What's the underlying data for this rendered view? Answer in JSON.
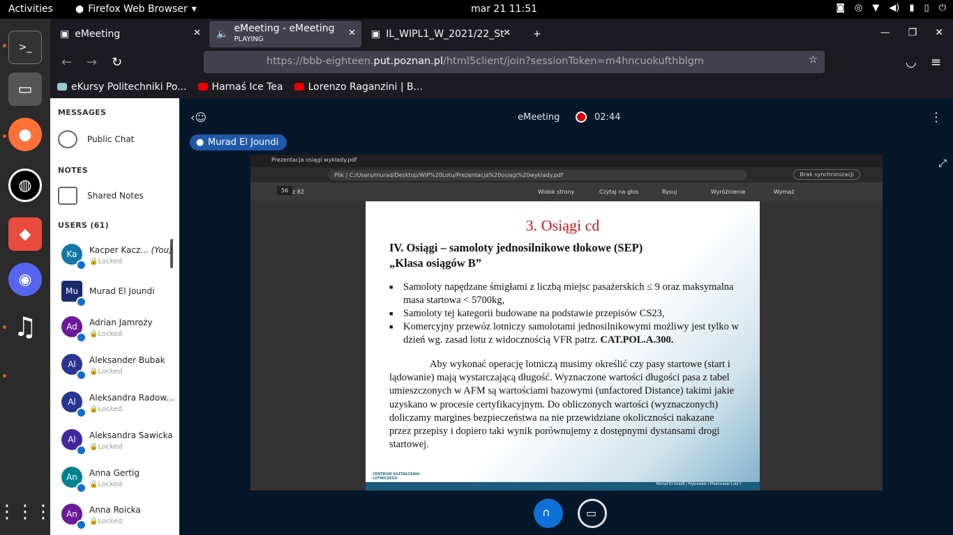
{
  "topbar": {
    "activities": "Activities",
    "app": "Firefox Web Browser",
    "clock": "mar 21  11:51"
  },
  "tabs": [
    {
      "title": "eMeeting"
    },
    {
      "title": "eMeeting - eMeeting",
      "sub": "PLAYING"
    },
    {
      "title": "IL_WIPL1_W_2021/22_St"
    }
  ],
  "url": {
    "host": "https://bbb-eighteen.",
    "domain": "put.poznan.pl",
    "path": "/html5client/join?sessionToken=m4hncuokufthblgm"
  },
  "bookmarks": [
    "eKursy Politechniki Po...",
    "Harnaś Ice Tea",
    "Lorenzo Raganzini | B..."
  ],
  "sidebar": {
    "messages": "MESSAGES",
    "public_chat": "Public Chat",
    "notes": "NOTES",
    "shared_notes": "Shared Notes",
    "users": "USERS (61)",
    "you": "(You)",
    "locked": "Locked"
  },
  "users": [
    {
      "initials": "Ka",
      "name": "Kacper Kacz...",
      "color": "#1477a8"
    },
    {
      "initials": "Mu",
      "name": "Murad El Joundi",
      "color": "#1a2a6c"
    },
    {
      "initials": "Ad",
      "name": "Adrian Jamroży",
      "color": "#6a1b9a"
    },
    {
      "initials": "Al",
      "name": "Aleksander Bubak",
      "color": "#283593"
    },
    {
      "initials": "Al",
      "name": "Aleksandra Radow...",
      "color": "#283593"
    },
    {
      "initials": "Al",
      "name": "Aleksandra Sawicka",
      "color": "#4527a0"
    },
    {
      "initials": "An",
      "name": "Anna Gertig",
      "color": "#00838f"
    },
    {
      "initials": "An",
      "name": "Anna Roicka",
      "color": "#6a1b9a"
    }
  ],
  "meeting": {
    "title": "eMeeting",
    "timer": "02:44",
    "presenter": "Murad El Joundi"
  },
  "edge": {
    "tab": "Prezentacja osiągi wykłady.pdf",
    "plik": "Plik",
    "path": "C:/Users/murad/Desktop/WiP%20Lotu/Prezentacja%20osiagi%20wyklady.pdf",
    "sync": "Brak synchronizacji",
    "page": "56",
    "of": "z 82",
    "tools": [
      "Widok strony",
      "Czytaj na głos",
      "Rysuj",
      "Wyróżnienie",
      "Wymaż"
    ]
  },
  "slide": {
    "title": "3. Osiągi cd",
    "h1": "IV.  Osiągi – samoloty jednosilnikowe tłokowe (SEP)",
    "h2": "„Klasa osiągów B”",
    "b1": "Samoloty napędzane śmigłami z liczbą miejsc pasażerskich ≤ 9 oraz maksymalna masa startowa < 5700kg,",
    "b2": "Samoloty tej kategorii budowane na podstawie przepisów CS23,",
    "b3a": "Komercyjny przewóz lotniczy samolotami jednosilnikowymi możliwy jest tylko w dzień wg. zasad lotu z widocznością VFR patrz. ",
    "b3b": "CAT.POL.A.300.",
    "para": "Aby wykonać operację lotniczą musimy określić czy pasy startowe (start i lądowanie) mają wystarczającą długość. Wyznaczone wartości długości pasa z tabel umieszczonych w AFM są wartościami bazowymi (unfactored Distance) takimi jakie uzyskano w procesie certyfikacyjnym. Do obliczonych wartości (wyznaczonych) doliczamy margines bezpieczeństwa na nie przewidziane okoliczności nakazane przez przepisy i dopiero taki wynik porównujemy z dostępnymi dystansami drogi startowej.",
    "logo": "CENTRUM KSZTAŁCENIA LOTNICZEGO",
    "footer": "Michał El Joundi  |  Wykonanie i Planowanie Lotu 1"
  }
}
